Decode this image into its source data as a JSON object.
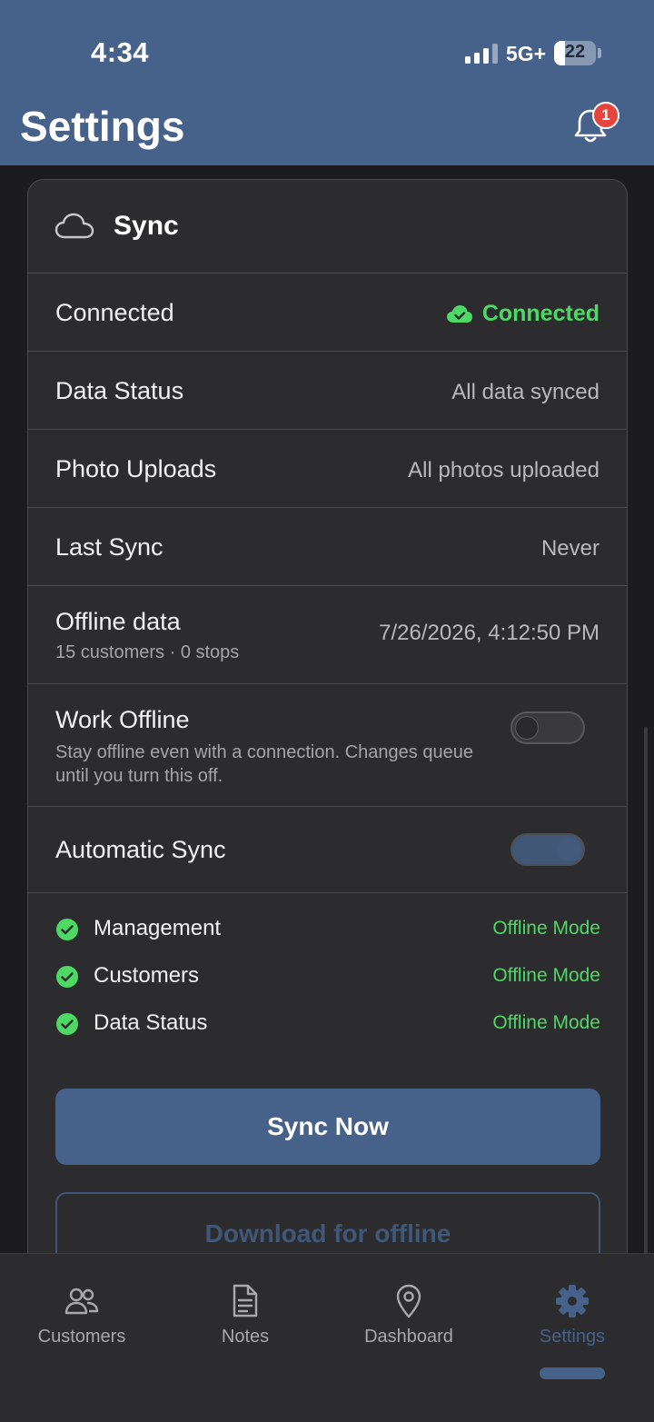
{
  "status_bar": {
    "time": "4:34",
    "network": "5G+",
    "battery": "22"
  },
  "header": {
    "title": "Settings",
    "notification_count": "1"
  },
  "sync_card": {
    "title": "Sync",
    "rows": {
      "connected": {
        "label": "Connected",
        "value": "Connected"
      },
      "data_status": {
        "label": "Data Status",
        "value": "All data synced"
      },
      "photo_uploads": {
        "label": "Photo Uploads",
        "value": "All photos uploaded"
      },
      "last_sync": {
        "label": "Last Sync",
        "value": "Never"
      },
      "offline_data": {
        "label": "Offline data",
        "sub": "15 customers · 0 stops",
        "value": "7/26/2026, 4:12:50 PM"
      },
      "work_offline": {
        "label": "Work Offline",
        "sub": "Stay offline even with a connection. Changes queue until you turn this off.",
        "enabled": false
      },
      "automatic_sync": {
        "label": "Automatic Sync",
        "enabled": true
      }
    },
    "modules": [
      {
        "label": "Management",
        "status": "Offline Mode"
      },
      {
        "label": "Customers",
        "status": "Offline Mode"
      },
      {
        "label": "Data Status",
        "status": "Offline Mode"
      }
    ],
    "sync_now_label": "Sync Now",
    "download_label": "Download for offline"
  },
  "tabs": [
    {
      "label": "Customers",
      "icon": "customers-icon"
    },
    {
      "label": "Notes",
      "icon": "notes-icon"
    },
    {
      "label": "Dashboard",
      "icon": "location-pin-icon"
    },
    {
      "label": "Settings",
      "icon": "gear-icon",
      "active": true
    }
  ],
  "colors": {
    "accent": "#47628a",
    "success": "#4cd964",
    "badge": "#e5453c",
    "card": "#2c2c2e",
    "background": "#1c1c1e"
  }
}
